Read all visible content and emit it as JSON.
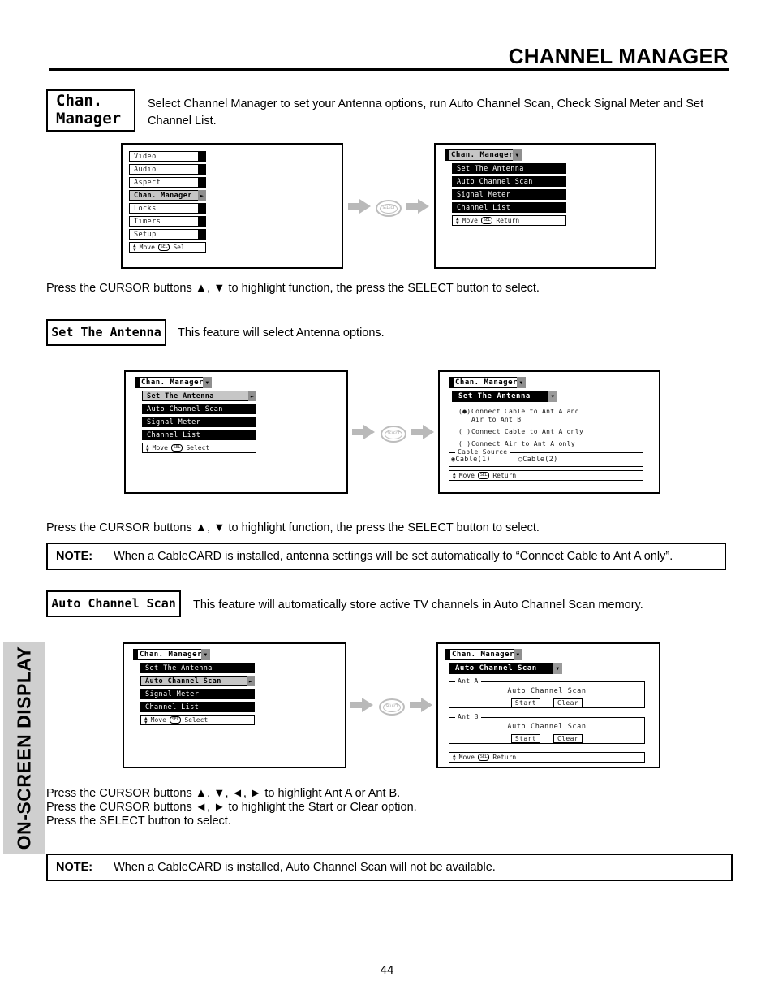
{
  "header": {
    "title": "CHANNEL MANAGER"
  },
  "side_tab": {
    "label": "ON-SCREEN DISPLAY"
  },
  "page_number": "44",
  "intro": {
    "chip_line1": "Chan.",
    "chip_line2": "Manager",
    "text": "Select Channel Manager to set your Antenna options, run Auto Channel Scan, Check Signal Meter and Set Channel List."
  },
  "instructions": {
    "line_updown": "Press the CURSOR buttons ▲, ▼ to highlight function, the press the SELECT button to select.",
    "scan_line1": "Press the CURSOR buttons ▲, ▼, ◄, ► to highlight Ant A or Ant B.",
    "scan_line2": "Press the CURSOR buttons ◄, ► to highlight the Start or Clear option.",
    "scan_line3": "Press the SELECT button to select."
  },
  "notes": {
    "label": "NOTE:",
    "antenna": "When a CableCARD is installed, antenna settings will be set automatically to “Connect Cable to Ant A only”.",
    "scan": "When a CableCARD is installed, Auto Channel Scan will not be available."
  },
  "sections": {
    "set_antenna": {
      "chip": "Set The Antenna",
      "text": "This feature will select Antenna options."
    },
    "auto_scan": {
      "chip": "Auto Channel Scan",
      "text": "This feature will automatically store active TV channels in Auto Channel Scan memory."
    }
  },
  "osd": {
    "main_menu": {
      "items": [
        "Video",
        "Audio",
        "Aspect",
        "Chan. Manager",
        "Locks",
        "Timers",
        "Setup"
      ],
      "selected_index": 3,
      "guide_move": "Move",
      "guide_chip": "SEL",
      "guide_action": "Sel"
    },
    "chan_manager": {
      "header": "Chan. Manager",
      "items": [
        "Set The Antenna",
        "Auto Channel Scan",
        "Signal Meter",
        "Channel List"
      ],
      "guide_move": "Move",
      "guide_chip": "SEL",
      "guide_action_return": "Return",
      "guide_action_select": "Select"
    },
    "antenna_panel": {
      "header": "Chan. Manager",
      "subheader": "Set The Antenna",
      "options": [
        {
          "marker": "(●)",
          "line1": "Connect Cable to Ant A and",
          "line2": "Air to Ant B"
        },
        {
          "marker": "( )",
          "line1": "Connect Cable to Ant A only",
          "line2": ""
        },
        {
          "marker": "( )",
          "line1": "Connect Air to Ant A only",
          "line2": ""
        }
      ],
      "cable_source_legend": "Cable Source",
      "cable_source_options": [
        {
          "marker": "◉",
          "label": "Cable(1)"
        },
        {
          "marker": "○",
          "label": "Cable(2)"
        }
      ],
      "guide_move": "Move",
      "guide_chip": "SEL",
      "guide_action": "Return"
    },
    "scan_panel": {
      "header": "Chan. Manager",
      "subheader": "Auto Channel Scan",
      "groups": [
        {
          "legend": "Ant A",
          "title": "Auto Channel Scan",
          "start": "Start",
          "clear": "Clear"
        },
        {
          "legend": "Ant B",
          "title": "Auto Channel Scan",
          "start": "Start",
          "clear": "Clear"
        }
      ],
      "guide_move": "Move",
      "guide_chip": "SEL",
      "guide_action": "Return"
    },
    "transition": {
      "select_label": "SELECT"
    }
  }
}
